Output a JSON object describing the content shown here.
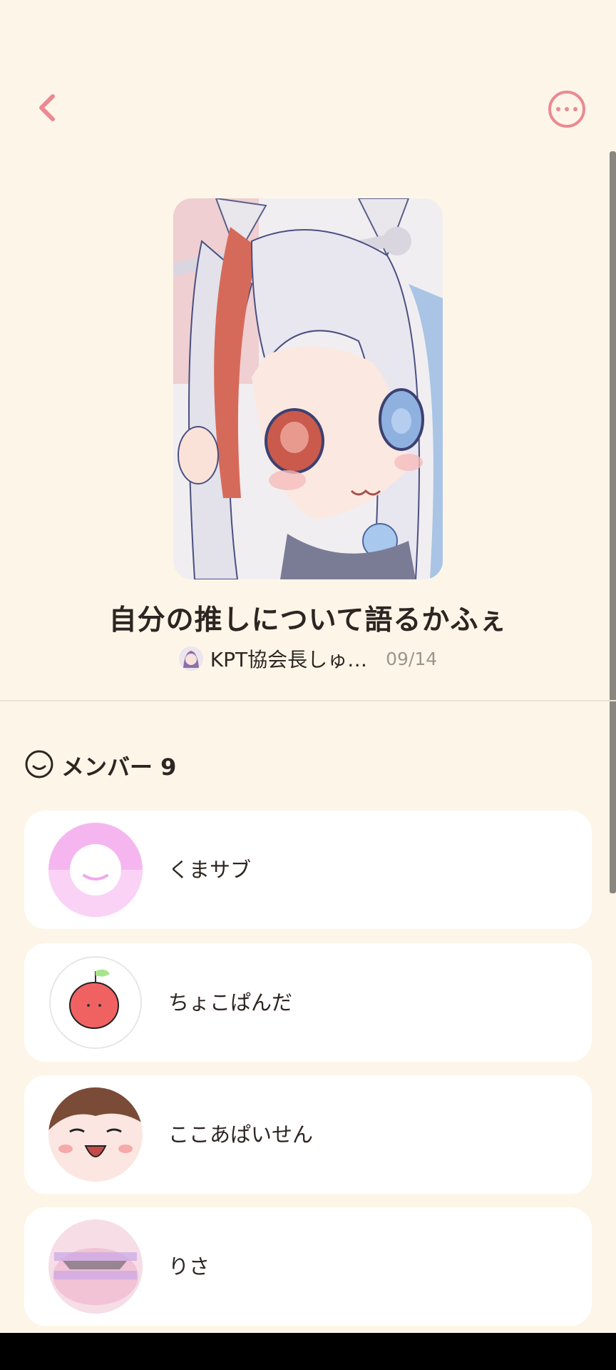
{
  "header": {
    "back_icon": "chevron-left-icon",
    "more_icon": "more-horizontal-icon",
    "accent_color": "#ea8a93"
  },
  "room": {
    "title": "自分の推しについて語るかふぇ",
    "host_name": "KPT協会長しゅ…",
    "date": "09/14"
  },
  "members": {
    "icon": "smile-icon",
    "title": "メンバー 9",
    "list": [
      {
        "name": "くまサブ"
      },
      {
        "name": "ちょこぱんだ"
      },
      {
        "name": "ここあぱいせん"
      },
      {
        "name": "りさ"
      }
    ]
  }
}
